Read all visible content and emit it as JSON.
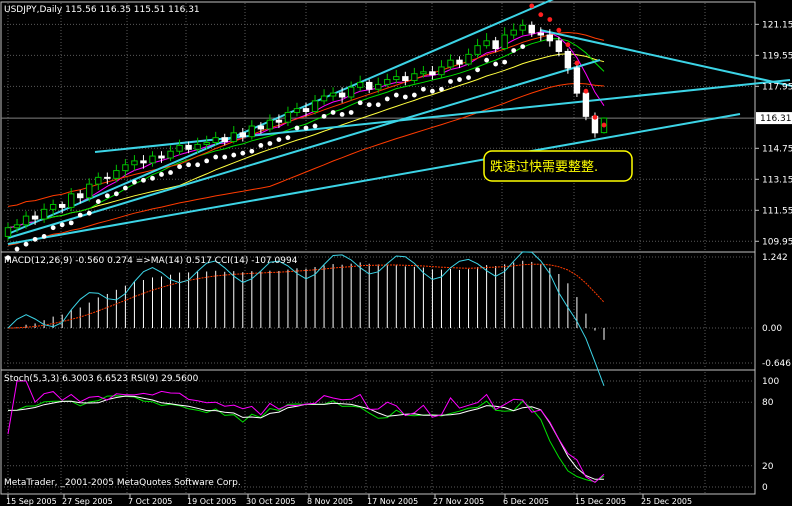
{
  "colors": {
    "background": "#000000",
    "frame": "#c0c0c0",
    "grid": "#5a5a5a",
    "bull": "#00c000",
    "bear": "#ffffff",
    "channel": "#3cd4e6",
    "ma_fast": "#ff00ff",
    "ma_mid": "#00e000",
    "ma_slow": "#ffff40",
    "ma_long": "#ff3b00",
    "sar": "#ffffff",
    "annotation_border": "#ffff00",
    "annotation_text": "#ffff00",
    "macd_hist": "#ffffff",
    "macd_signal": "#ff3b00",
    "cci": "#3cd4e6",
    "stoch_main": "#00e000",
    "stoch_signal": "#ffffff",
    "rsi": "#ff00ff"
  },
  "chart_data": [
    {
      "type": "candlestick",
      "title": "USDJPY,Daily  115.56 116.35 115.51 116.31",
      "current_price_label": "116.31",
      "annotation": "跌速过快需要整整.",
      "y_ticks": [
        "121.15",
        "119.55",
        "117.95",
        "116.31",
        "114.75",
        "113.15",
        "111.55",
        "109.95"
      ],
      "ylim": [
        109.5,
        122.2
      ],
      "dates": [
        "2005-09-15",
        "2005-09-16",
        "2005-09-19",
        "2005-09-20",
        "2005-09-21",
        "2005-09-22",
        "2005-09-23",
        "2005-09-26",
        "2005-09-27",
        "2005-09-28",
        "2005-09-29",
        "2005-09-30",
        "2005-10-03",
        "2005-10-04",
        "2005-10-05",
        "2005-10-06",
        "2005-10-07",
        "2005-10-10",
        "2005-10-11",
        "2005-10-12",
        "2005-10-13",
        "2005-10-14",
        "2005-10-17",
        "2005-10-18",
        "2005-10-19",
        "2005-10-20",
        "2005-10-21",
        "2005-10-24",
        "2005-10-25",
        "2005-10-26",
        "2005-10-27",
        "2005-10-28",
        "2005-10-31",
        "2005-11-01",
        "2005-11-02",
        "2005-11-03",
        "2005-11-04",
        "2005-11-07",
        "2005-11-08",
        "2005-11-09",
        "2005-11-10",
        "2005-11-11",
        "2005-11-14",
        "2005-11-15",
        "2005-11-16",
        "2005-11-17",
        "2005-11-18",
        "2005-11-21",
        "2005-11-22",
        "2005-11-23",
        "2005-11-24",
        "2005-11-25",
        "2005-11-28",
        "2005-11-29",
        "2005-11-30",
        "2005-12-01",
        "2005-12-02",
        "2005-12-05",
        "2005-12-06",
        "2005-12-07",
        "2005-12-08",
        "2005-12-09",
        "2005-12-12",
        "2005-12-13",
        "2005-12-14",
        "2005-12-15",
        "2005-12-16"
      ],
      "x_tick_labels": [
        "15 Sep 2005",
        "27 Sep 2005",
        "7 Oct 2005",
        "19 Oct 2005",
        "30 Oct 2005",
        "8 Nov 2005",
        "17 Nov 2005",
        "27 Nov 2005",
        "6 Dec 2005",
        "15 Dec 2005",
        "25 Dec 2005"
      ],
      "close": [
        110.65,
        110.8,
        111.25,
        111.1,
        111.6,
        111.85,
        111.7,
        112.4,
        112.2,
        112.9,
        113.25,
        113.2,
        113.6,
        113.9,
        114.1,
        114.0,
        114.35,
        114.25,
        114.6,
        114.9,
        114.7,
        114.95,
        115.05,
        115.3,
        115.1,
        115.55,
        115.35,
        115.9,
        115.75,
        116.2,
        116.1,
        116.6,
        116.8,
        116.65,
        117.2,
        117.45,
        117.6,
        117.4,
        117.9,
        118.15,
        117.8,
        118.05,
        118.3,
        118.45,
        118.25,
        118.6,
        118.7,
        118.55,
        118.95,
        119.3,
        119.1,
        119.6,
        120.05,
        120.3,
        119.9,
        120.6,
        120.85,
        121.1,
        120.7,
        120.6,
        120.3,
        119.75,
        118.9,
        117.6,
        116.4,
        115.55,
        116.31
      ],
      "open": [
        110.2,
        110.65,
        110.8,
        111.25,
        111.1,
        111.6,
        111.85,
        111.7,
        112.4,
        112.2,
        112.9,
        113.25,
        113.2,
        113.6,
        113.9,
        114.1,
        114.0,
        114.35,
        114.25,
        114.6,
        114.9,
        114.7,
        114.95,
        115.05,
        115.3,
        115.1,
        115.55,
        115.35,
        115.9,
        115.75,
        116.2,
        116.1,
        116.6,
        116.8,
        116.65,
        117.2,
        117.45,
        117.6,
        117.4,
        117.9,
        118.15,
        117.8,
        118.05,
        118.3,
        118.45,
        118.25,
        118.6,
        118.7,
        118.55,
        118.95,
        119.3,
        119.1,
        119.6,
        120.05,
        120.3,
        119.9,
        120.6,
        120.85,
        121.1,
        120.7,
        120.6,
        120.3,
        119.75,
        118.9,
        117.6,
        116.4,
        115.56
      ],
      "high": [
        110.9,
        111.1,
        111.5,
        111.5,
        111.9,
        112.1,
        112.0,
        112.7,
        112.6,
        113.2,
        113.5,
        113.5,
        113.9,
        114.2,
        114.4,
        114.4,
        114.6,
        114.6,
        114.9,
        115.2,
        115.1,
        115.3,
        115.4,
        115.6,
        115.5,
        115.9,
        115.8,
        116.2,
        116.1,
        116.5,
        116.5,
        116.9,
        117.1,
        117.1,
        117.5,
        117.8,
        117.9,
        117.9,
        118.2,
        118.5,
        118.3,
        118.4,
        118.6,
        118.8,
        118.7,
        118.9,
        119.0,
        119.0,
        119.3,
        119.6,
        119.5,
        119.9,
        120.4,
        120.7,
        120.5,
        121.0,
        121.2,
        121.4,
        121.3,
        121.0,
        120.9,
        120.5,
        119.9,
        119.1,
        117.8,
        116.6,
        116.35
      ],
      "low": [
        110.0,
        110.4,
        110.6,
        110.8,
        110.9,
        111.3,
        111.4,
        111.5,
        111.9,
        112.0,
        112.6,
        112.9,
        113.0,
        113.3,
        113.6,
        113.7,
        113.8,
        114.0,
        114.1,
        114.4,
        114.5,
        114.5,
        114.7,
        114.9,
        114.9,
        115.0,
        115.1,
        115.2,
        115.5,
        115.6,
        115.8,
        115.9,
        116.4,
        116.4,
        116.5,
        117.0,
        117.2,
        117.1,
        117.2,
        117.7,
        117.6,
        117.6,
        117.9,
        118.1,
        118.0,
        118.1,
        118.4,
        118.3,
        118.4,
        118.8,
        118.9,
        119.0,
        119.4,
        119.9,
        119.7,
        119.8,
        120.4,
        120.6,
        120.5,
        120.3,
        120.0,
        119.5,
        118.6,
        117.4,
        116.2,
        115.3,
        115.51
      ],
      "sar_dots_count": 58
    },
    {
      "type": "line",
      "title": "MACD(12,26,9) -0.560 0.274 =>MA(14) 0.517  CCI(14) -107.0994",
      "y_ticks": [
        "1.242",
        "0.00",
        "-0.646"
      ]
    },
    {
      "type": "line",
      "title": "Stoch(5,3,3) 6.3003 6.6523  RSI(9) 29.5600",
      "y_ticks": [
        "100",
        "80",
        "20",
        "0"
      ],
      "ylim": [
        0,
        100
      ]
    }
  ],
  "footer": "MetaTrader, _2001-2005 MetaQuotes Software Corp."
}
